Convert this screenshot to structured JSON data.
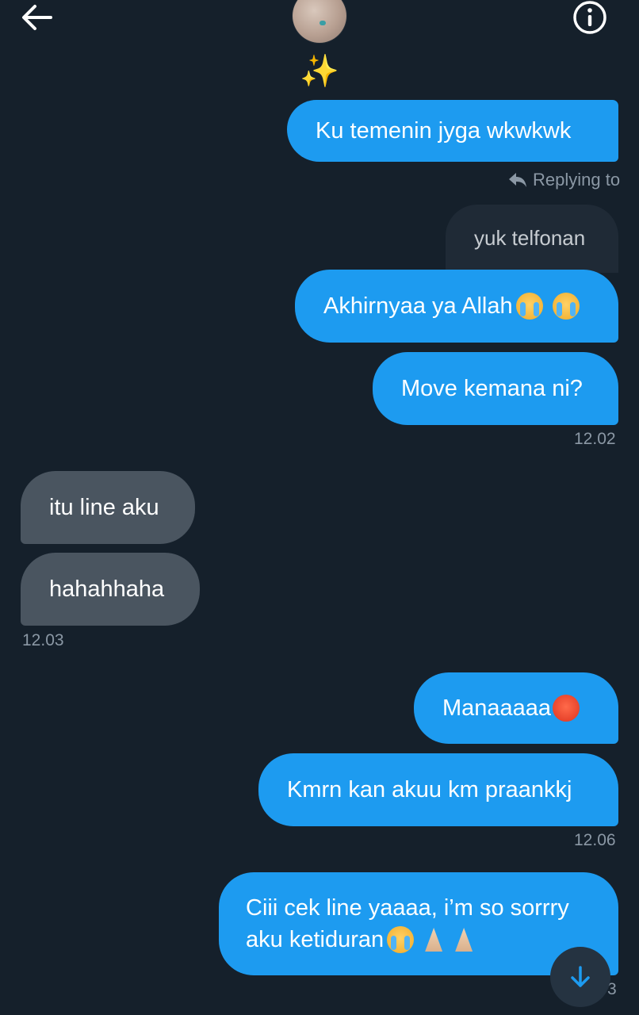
{
  "header": {
    "back_icon": "arrow-left-icon",
    "info_icon": "info-circle-icon",
    "avatar_alt": "",
    "status_emoji": "✨"
  },
  "reply_indicator": {
    "icon": "reply-arrow-icon",
    "label": "Replying to"
  },
  "quoted_message": {
    "text": "yuk telfonan"
  },
  "messages": [
    {
      "side": "out",
      "text": "Ku temenin jyga wkwkwk"
    },
    {
      "side": "out",
      "text": "Akhirnyaa ya Allah",
      "emojis": [
        "loudly-crying-face",
        "loudly-crying-face"
      ]
    },
    {
      "side": "out",
      "text": "Move kemana ni?"
    },
    {
      "side": "in",
      "text": "itu line aku"
    },
    {
      "side": "in",
      "text": "hahahhaha"
    },
    {
      "side": "out",
      "text": "Manaaaaa",
      "emojis": [
        "pouting-face"
      ]
    },
    {
      "side": "out",
      "text": "Kmrn kan akuu km praankkj"
    },
    {
      "side": "out",
      "text_line1": "Ciii cek line yaaaa, i’m so sorrry",
      "text_line2": "aku ketiduran",
      "emojis": [
        "loudly-crying-face",
        "folded-hands",
        "folded-hands"
      ]
    }
  ],
  "timestamps": {
    "t1": "12.02",
    "t2": "12.03",
    "t3": "12.06",
    "t4_partial": "3"
  },
  "scroll_button": {
    "icon": "arrow-down-icon"
  },
  "colors": {
    "background": "#15202b",
    "outgoing_bubble": "#1d9bf0",
    "incoming_bubble": "#4a5560",
    "timestamp": "#8b98a5"
  }
}
